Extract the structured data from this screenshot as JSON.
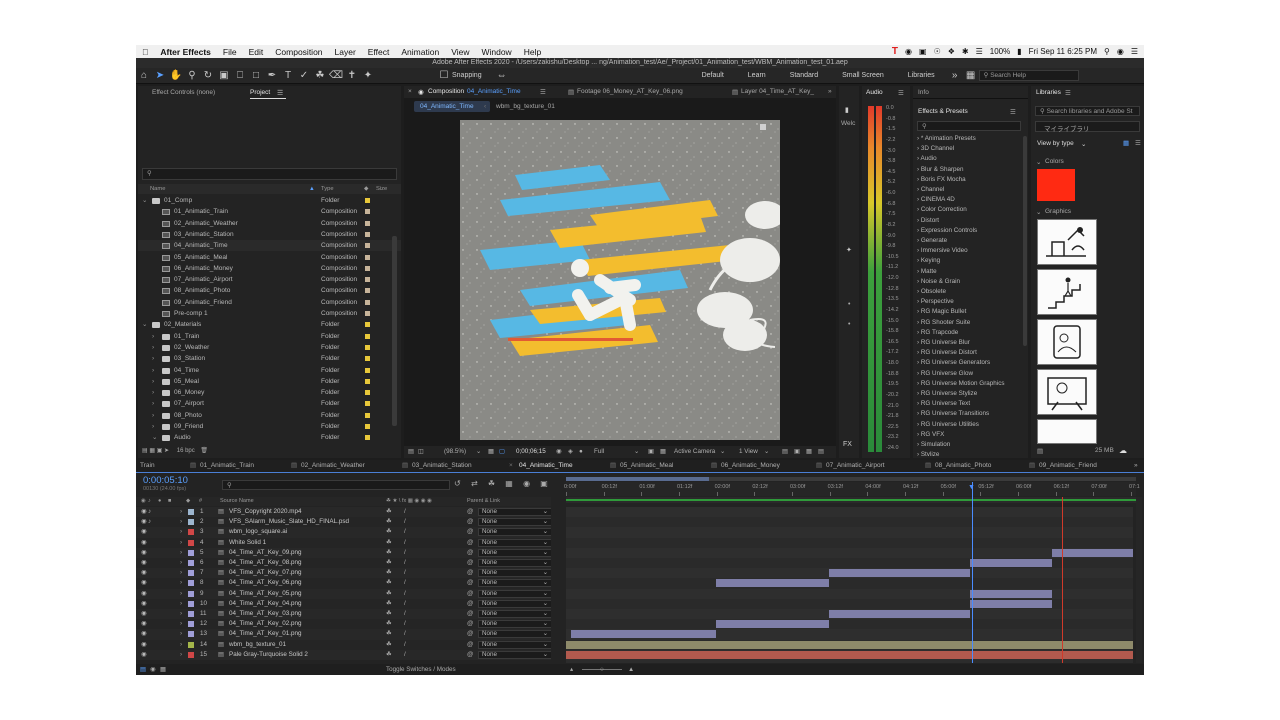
{
  "menubar": {
    "app_name": "After Effects",
    "items": [
      "File",
      "Edit",
      "Composition",
      "Layer",
      "Effect",
      "Animation",
      "View",
      "Window",
      "Help"
    ],
    "battery": "100%",
    "clock": "Fri Sep 11  6:25 PM"
  },
  "window_title": "Adobe After Effects 2020 - /Users/zakishu/Desktop ... ng/Animation_test/Ae/_Project/01_Animation_test/WBM_Animation_test_01.aep",
  "toolbar": {
    "snapping_label": "Snapping",
    "workspaces": [
      "Default",
      "Learn",
      "Standard",
      "Small Screen",
      "Libraries"
    ],
    "search_help": "Search Help"
  },
  "project_panel": {
    "tab_effect_controls": "Effect Controls (none)",
    "tab_project": "Project",
    "col_name": "Name",
    "col_type": "Type",
    "col_size": "Size",
    "bpc": "16 bpc",
    "items": [
      {
        "indent": 0,
        "kind": "folder",
        "open": true,
        "name": "01_Comp",
        "type": "Folder",
        "color": "#e8c83a"
      },
      {
        "indent": 1,
        "kind": "comp",
        "name": "01_Animatic_Train",
        "type": "Composition",
        "color": "#c7b49a"
      },
      {
        "indent": 1,
        "kind": "comp",
        "name": "02_Animatic_Weather",
        "type": "Composition",
        "color": "#c7b49a"
      },
      {
        "indent": 1,
        "kind": "comp",
        "name": "03_Animatic_Station",
        "type": "Composition",
        "color": "#c7b49a"
      },
      {
        "indent": 1,
        "kind": "comp",
        "name": "04_Animatic_Time",
        "type": "Composition",
        "color": "#c7b49a"
      },
      {
        "indent": 1,
        "kind": "comp",
        "name": "05_Animatic_Meal",
        "type": "Composition",
        "color": "#c7b49a"
      },
      {
        "indent": 1,
        "kind": "comp",
        "name": "06_Animatic_Money",
        "type": "Composition",
        "color": "#c7b49a"
      },
      {
        "indent": 1,
        "kind": "comp",
        "name": "07_Animatic_Airport",
        "type": "Composition",
        "color": "#c7b49a"
      },
      {
        "indent": 1,
        "kind": "comp",
        "name": "08_Animatic_Photo",
        "type": "Composition",
        "color": "#c7b49a"
      },
      {
        "indent": 1,
        "kind": "comp",
        "name": "09_Animatic_Friend",
        "type": "Composition",
        "color": "#c7b49a"
      },
      {
        "indent": 1,
        "kind": "comp",
        "name": "Pre-comp 1",
        "type": "Composition",
        "color": "#c7b49a"
      },
      {
        "indent": 0,
        "kind": "folder",
        "open": true,
        "name": "02_Materials",
        "type": "Folder",
        "color": "#e8c83a"
      },
      {
        "indent": 1,
        "kind": "folder",
        "name": "01_Train",
        "type": "Folder",
        "color": "#e8c83a"
      },
      {
        "indent": 1,
        "kind": "folder",
        "name": "02_Weather",
        "type": "Folder",
        "color": "#e8c83a"
      },
      {
        "indent": 1,
        "kind": "folder",
        "name": "03_Station",
        "type": "Folder",
        "color": "#e8c83a"
      },
      {
        "indent": 1,
        "kind": "folder",
        "name": "04_Time",
        "type": "Folder",
        "color": "#e8c83a"
      },
      {
        "indent": 1,
        "kind": "folder",
        "name": "05_Meal",
        "type": "Folder",
        "color": "#e8c83a"
      },
      {
        "indent": 1,
        "kind": "folder",
        "name": "06_Money",
        "type": "Folder",
        "color": "#e8c83a"
      },
      {
        "indent": 1,
        "kind": "folder",
        "name": "07_Airport",
        "type": "Folder",
        "color": "#e8c83a"
      },
      {
        "indent": 1,
        "kind": "folder",
        "name": "08_Photo",
        "type": "Folder",
        "color": "#e8c83a"
      },
      {
        "indent": 1,
        "kind": "folder",
        "name": "09_Friend",
        "type": "Folder",
        "color": "#e8c83a"
      },
      {
        "indent": 1,
        "kind": "folder",
        "open": true,
        "name": "Audio",
        "type": "Folder",
        "color": "#e8c83a"
      }
    ]
  },
  "viewer": {
    "tab_composition": "Composition",
    "comp_name": "04_Animatic_Time",
    "tab_footage": "Footage 06_Money_AT_Key_06.png",
    "tab_layer": "Layer 04_Time_AT_Key_",
    "sub_tab_active": "04_Animatic_Time",
    "sub_tab_other": "wbm_bg_texture_01",
    "zoom": "(98.5%)",
    "timecode": "0;00;06;15",
    "resolution": "Full",
    "camera": "Active Camera",
    "views": "1 View",
    "side_label": "Welc"
  },
  "audio_panel": {
    "title": "Audio",
    "scale": [
      "0.0",
      "-0.8",
      "-1.5",
      "-2.2",
      "-3.0",
      "-3.8",
      "-4.5",
      "-5.2",
      "-6.0",
      "-6.8",
      "-7.5",
      "-8.2",
      "-9.0",
      "-9.8",
      "-10.5",
      "-11.2",
      "-12.0",
      "-12.8",
      "-13.5",
      "-14.2",
      "-15.0",
      "-15.8",
      "-16.5",
      "-17.2",
      "-18.0",
      "-18.8",
      "-19.5",
      "-20.2",
      "-21.0",
      "-21.8",
      "-22.5",
      "-23.2",
      "-24.0"
    ]
  },
  "effects_panel": {
    "title_info": "Info",
    "title": "Effects & Presets",
    "items": [
      "* Animation Presets",
      "3D Channel",
      "Audio",
      "Blur & Sharpen",
      "Boris FX Mocha",
      "Channel",
      "CINEMA 4D",
      "Color Correction",
      "Distort",
      "Expression Controls",
      "Generate",
      "Immersive Video",
      "Keying",
      "Matte",
      "Noise & Grain",
      "Obsolete",
      "Perspective",
      "RG Magic Bullet",
      "RG Shooter Suite",
      "RG Trapcode",
      "RG Universe Blur",
      "RG Universe Distort",
      "RG Universe Generators",
      "RG Universe Glow",
      "RG Universe Motion Graphics",
      "RG Universe Stylize",
      "RG Universe Text",
      "RG Universe Transitions",
      "RG Universe Utilities",
      "RG VFX",
      "Simulation",
      "Stylize"
    ]
  },
  "libraries_panel": {
    "title": "Libraries",
    "search_placeholder": "Search libraries and Adobe St",
    "library_name": "マイライブラリ",
    "view_by": "View by type",
    "colors_label": "Colors",
    "swatch_color": "#ff2a12",
    "graphics_label": "Graphics",
    "size": "25 MB"
  },
  "timeline": {
    "tabs": [
      "Train",
      "01_Animatic_Train",
      "02_Animatic_Weather",
      "03_Animatic_Station",
      "04_Animatic_Time",
      "05_Animatic_Meal",
      "06_Animatic_Money",
      "07_Animatic_Airport",
      "08_Animatic_Photo",
      "09_Animatic_Friend"
    ],
    "active_tab": "04_Animatic_Time",
    "timecode": "0:00:05:10",
    "fps": "00130 (24.00 fps)",
    "col_source": "Source Name",
    "col_parent": "Parent & Link",
    "toggle_label": "Toggle Switches / Modes",
    "ruler": [
      "0:00f",
      "00:12f",
      "01:00f",
      "01:12f",
      "02:00f",
      "02:12f",
      "03:00f",
      "03:12f",
      "04:00f",
      "04:12f",
      "05:00f",
      "05:12f",
      "06:00f",
      "06:12f",
      "07:00f",
      "07:1"
    ],
    "layers": [
      {
        "num": "1",
        "name": "VFS_Copyright 2020.mp4",
        "label": "#9db6cf",
        "parent": "None"
      },
      {
        "num": "2",
        "name": "VFS_SAlarm_Music_Slate_HD_FINAL.psd",
        "label": "#9db6cf",
        "parent": "None"
      },
      {
        "num": "3",
        "name": "wbm_logo_square.ai",
        "label": "#d04747",
        "parent": "None"
      },
      {
        "num": "4",
        "name": "White Solid 1",
        "label": "#d04747",
        "parent": "None"
      },
      {
        "num": "5",
        "name": "04_Time_AT_Key_09.png",
        "label": "#a09ed8",
        "parent": "None"
      },
      {
        "num": "6",
        "name": "04_Time_AT_Key_08.png",
        "label": "#a09ed8",
        "parent": "None"
      },
      {
        "num": "7",
        "name": "04_Time_AT_Key_07.png",
        "label": "#a09ed8",
        "parent": "None"
      },
      {
        "num": "8",
        "name": "04_Time_AT_Key_06.png",
        "label": "#a09ed8",
        "parent": "None"
      },
      {
        "num": "9",
        "name": "04_Time_AT_Key_05.png",
        "label": "#a09ed8",
        "parent": "None"
      },
      {
        "num": "10",
        "name": "04_Time_AT_Key_04.png",
        "label": "#a09ed8",
        "parent": "None"
      },
      {
        "num": "11",
        "name": "04_Time_AT_Key_03.png",
        "label": "#a09ed8",
        "parent": "None"
      },
      {
        "num": "12",
        "name": "04_Time_AT_Key_02.png",
        "label": "#a09ed8",
        "parent": "None"
      },
      {
        "num": "13",
        "name": "04_Time_AT_Key_01.png",
        "label": "#a09ed8",
        "parent": "None"
      },
      {
        "num": "14",
        "name": "wbm_bg_texture_01",
        "label": "#a4b54a",
        "parent": "None"
      },
      {
        "num": "15",
        "name": "Pale Gray-Turquoise Solid 2",
        "label": "#d04747",
        "parent": "None"
      }
    ]
  }
}
